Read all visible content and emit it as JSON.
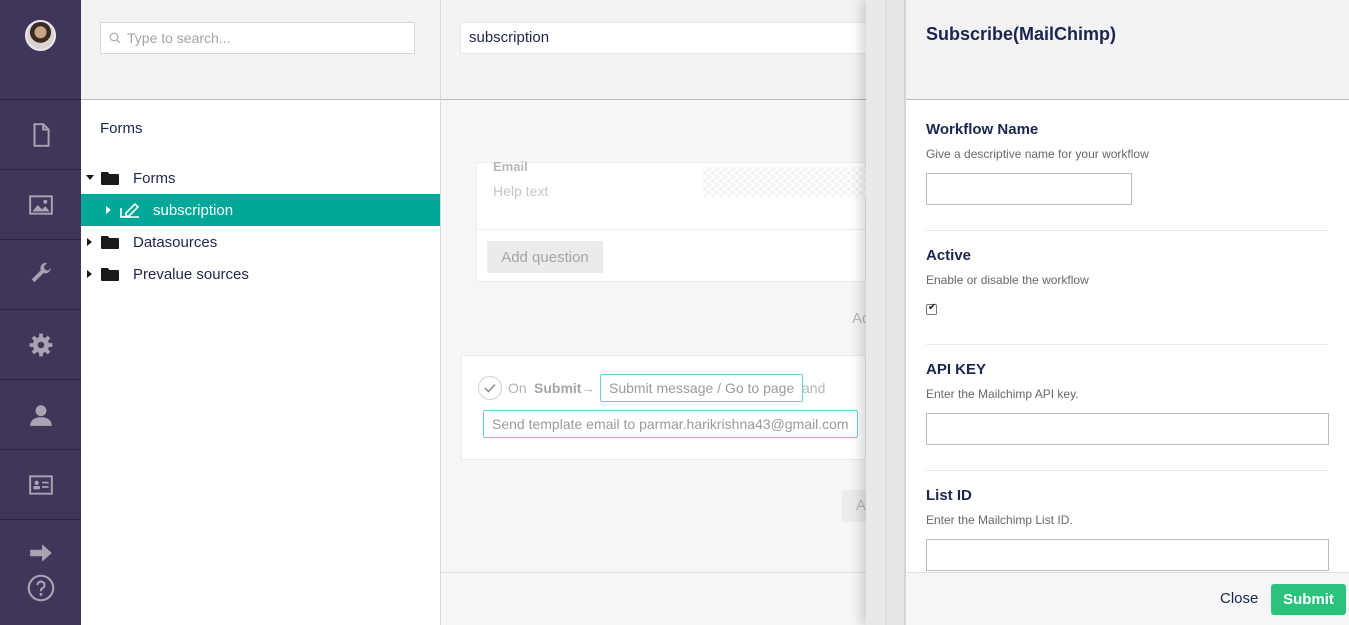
{
  "tree": {
    "search_placeholder": "Type to search...",
    "section_title": "Forms",
    "nodes": [
      {
        "label": "Forms",
        "expanded": true
      },
      {
        "label": "subscription",
        "selected": true
      },
      {
        "label": "Datasources"
      },
      {
        "label": "Prevalue sources"
      }
    ]
  },
  "main": {
    "form_name": "subscription",
    "field_label": "Email",
    "help_text": "Help text",
    "add_question": "Add question",
    "ad_partial": "Ac",
    "workflow": {
      "on": "On",
      "submit": "Submit",
      "arrow": "→",
      "chip1": "Submit message / Go to page",
      "and": "and",
      "chip2": "Send template email to parmar.harikrishna43@gmail.com"
    },
    "add_partial": "A"
  },
  "overlay": {
    "title": "Subscribe(MailChimp)",
    "props": [
      {
        "label": "Workflow Name",
        "description": "Give a descriptive name for your workflow",
        "value": ""
      },
      {
        "label": "Active",
        "description": "Enable or disable the workflow",
        "checked": true
      },
      {
        "label": "API KEY",
        "description": "Enter the Mailchimp API key.",
        "value": ""
      },
      {
        "label": "List ID",
        "description": "Enter the Mailchimp List ID.",
        "value": ""
      }
    ],
    "close_label": "Close",
    "submit_label": "Submit"
  },
  "colors": {
    "rail": "#413659",
    "selected_node": "#00a89a",
    "submit_button": "#2bc37c",
    "workflow_chip_border": "#6fd5cc"
  }
}
